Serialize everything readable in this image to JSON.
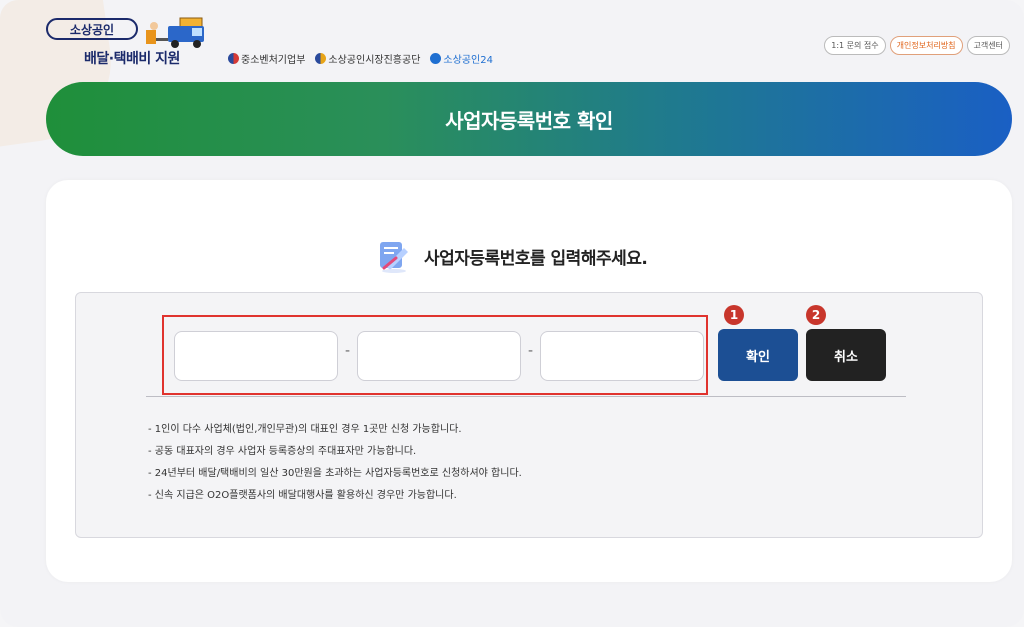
{
  "header": {
    "logo_top": "소상공인",
    "logo_sub": "배달·택배비 지원",
    "orgs": [
      {
        "label": "중소벤처기업부",
        "color": "#2a4a9c"
      },
      {
        "label": "소상공인시장진흥공단",
        "color": "#e8a417"
      },
      {
        "label": "소상공인24",
        "color": "#1f6fd1"
      }
    ],
    "top_links": [
      {
        "label": "1:1 문의 접수",
        "accent": false
      },
      {
        "label": "개인정보처리방침",
        "accent": true
      },
      {
        "label": "고객센터",
        "accent": false
      }
    ]
  },
  "banner": {
    "title": "사업자등록번호 확인"
  },
  "form": {
    "heading": "사업자등록번호를 입력해주세요.",
    "inputs": [
      {
        "value": "",
        "placeholder": ""
      },
      {
        "value": "",
        "placeholder": ""
      },
      {
        "value": "",
        "placeholder": ""
      }
    ],
    "separator": "-",
    "confirm_label": "확인",
    "cancel_label": "취소",
    "badge_1": "1",
    "badge_2": "2"
  },
  "notes": [
    "- 1인이 다수 사업체(법인,개인무관)의 대표인 경우 1곳만 신청 가능합니다.",
    "- 공동 대표자의 경우 사업자 등록증상의 주대표자만 가능합니다.",
    "- 24년부터 배달/택배비의 일산 30만원을 초과하는 사업자등록번호로 신청하셔야 합니다.",
    "- 신속 지급은 O2O플랫폼사의 배달대행사를 활용하신 경우만 가능합니다."
  ]
}
